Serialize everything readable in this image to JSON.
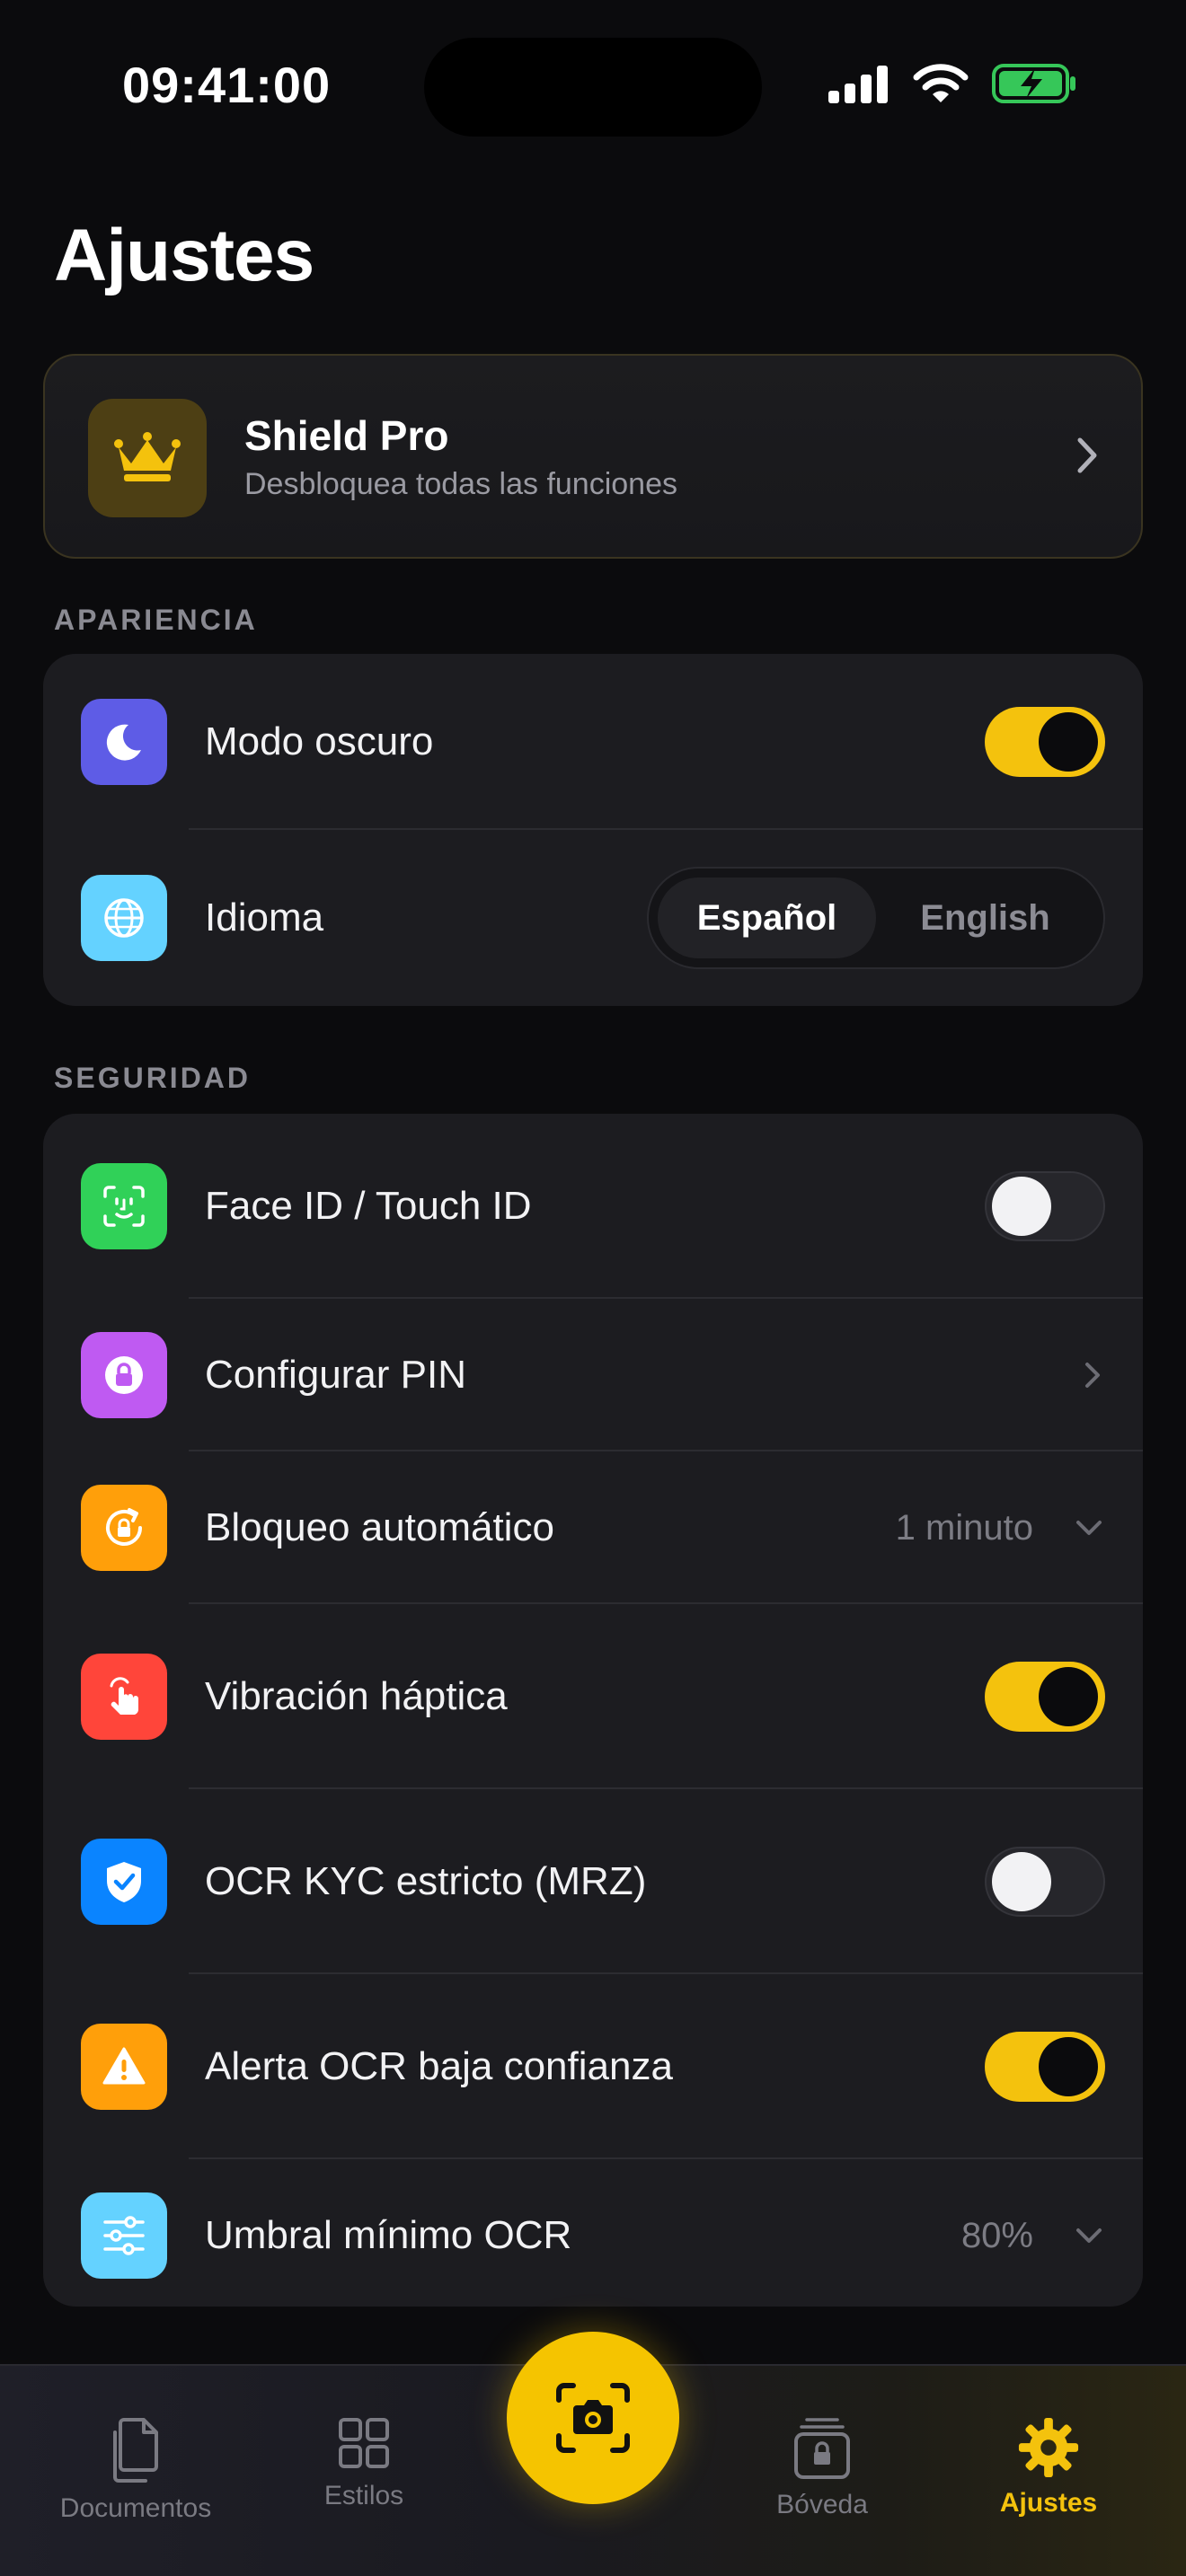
{
  "status_bar": {
    "time": "09:41:00"
  },
  "page": {
    "title": "Ajustes"
  },
  "pro_card": {
    "title": "Shield Pro",
    "subtitle": "Desbloquea todas las funciones",
    "icon": "crown-icon"
  },
  "sections": {
    "appearance": {
      "header": "APARIENCIA",
      "dark_mode": {
        "label": "Modo oscuro",
        "enabled": true
      },
      "language": {
        "label": "Idioma",
        "options": [
          "Español",
          "English"
        ],
        "selected": "Español"
      }
    },
    "security": {
      "header": "SEGURIDAD",
      "face_id": {
        "label": "Face ID / Touch ID",
        "enabled": false
      },
      "pin": {
        "label": "Configurar PIN"
      },
      "auto_lock": {
        "label": "Bloqueo automático",
        "value": "1 minuto"
      },
      "haptics": {
        "label": "Vibración háptica",
        "enabled": true
      },
      "ocr_kyc": {
        "label": "OCR KYC estricto (MRZ)",
        "enabled": false
      },
      "ocr_alert": {
        "label": "Alerta OCR baja confianza",
        "enabled": true
      },
      "ocr_threshold": {
        "label": "Umbral mínimo OCR",
        "value": "80%"
      }
    }
  },
  "tab_bar": {
    "documents": "Documentos",
    "styles": "Estilos",
    "vault": "Bóveda",
    "settings": "Ajustes",
    "active": "settings"
  },
  "colors": {
    "accent": "#f4c20d",
    "background": "#0b0b0d",
    "card": "#1c1c20",
    "moon": "#5e5ce6",
    "globe": "#64d2ff",
    "face": "#30d158",
    "pin": "#bf5af2",
    "autolock": "#ff9f0a",
    "haptic": "#ff453a",
    "shield": "#0a84ff",
    "warning": "#ff9f0a",
    "sliders": "#64d2ff"
  }
}
